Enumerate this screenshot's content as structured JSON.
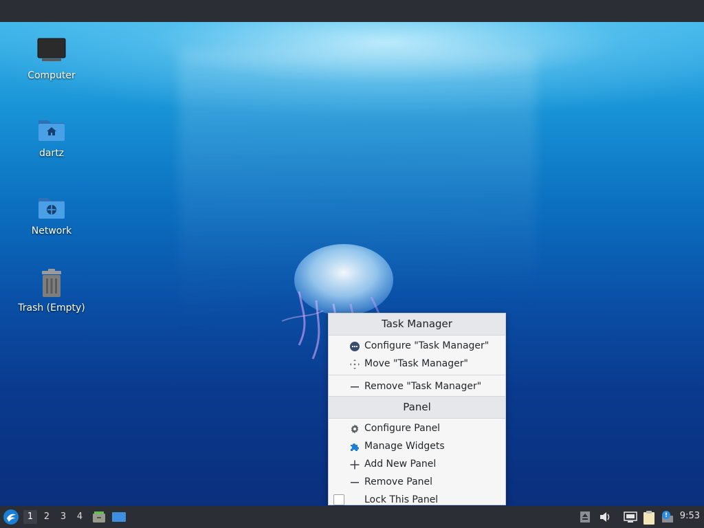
{
  "desktop": {
    "icons": [
      {
        "label": "Computer",
        "icon": "monitor-icon"
      },
      {
        "label": "dartz",
        "icon": "home-folder-icon"
      },
      {
        "label": "Network",
        "icon": "network-folder-icon"
      },
      {
        "label": "Trash (Empty)",
        "icon": "trash-icon"
      }
    ]
  },
  "context_menu": {
    "task_manager": {
      "title": "Task Manager",
      "items": [
        {
          "label": "Configure \"Task Manager\"",
          "icon": "configure-widget-icon"
        },
        {
          "label": "Move \"Task Manager\"",
          "icon": "move-icon"
        },
        {
          "label": "Remove \"Task Manager\"",
          "icon": "remove-icon"
        }
      ]
    },
    "panel": {
      "title": "Panel",
      "items": [
        {
          "label": "Configure Panel",
          "icon": "gear-icon"
        },
        {
          "label": "Manage Widgets",
          "icon": "puzzle-icon"
        },
        {
          "label": "Add New Panel",
          "icon": "plus-icon"
        },
        {
          "label": "Remove Panel",
          "icon": "remove-icon"
        },
        {
          "label": "Lock This Panel",
          "icon": "checkbox-icon",
          "checked": false
        }
      ]
    }
  },
  "taskbar": {
    "desktops": [
      "1",
      "2",
      "3",
      "4"
    ],
    "active_desktop": "1",
    "clock": "9:53",
    "tray_icons": [
      "updates-icon",
      "volume-icon",
      "network-wired-icon",
      "clipboard-icon",
      "notifications-icon"
    ],
    "launchers": [
      "file-manager-icon",
      "show-desktop-icon"
    ]
  },
  "colors": {
    "panel_bg": "#2c2e35",
    "menu_bg": "#f6f6f7",
    "accent_blue": "#1d7fd3"
  }
}
